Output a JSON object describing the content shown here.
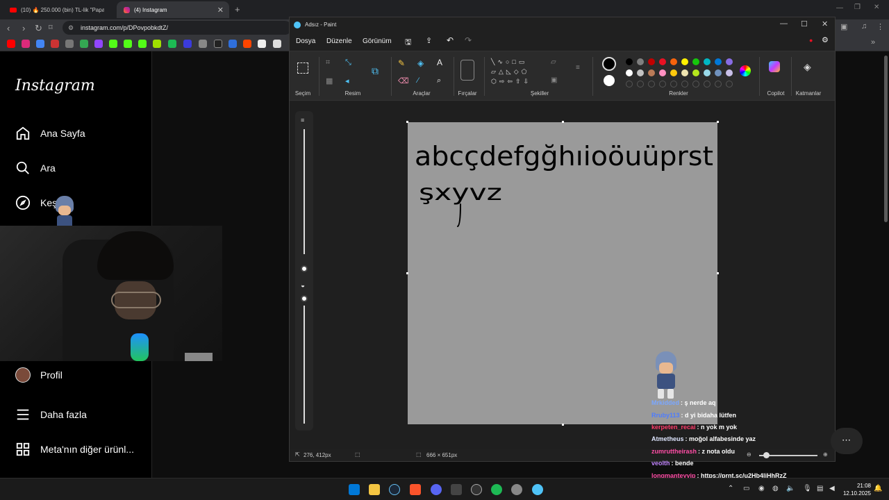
{
  "browser": {
    "tabs": [
      {
        "label": "(10) 🔥 250.000 (bin) TL-lik \"Papa",
        "active": false
      },
      {
        "label": "(4) Instagram",
        "active": true
      }
    ],
    "new_tab_label": "+",
    "url": "instagram.com/p/DPovpobkdtZ/"
  },
  "instagram": {
    "logo": "Instagram",
    "nav": [
      {
        "label": "Ana Sayfa",
        "icon": "home-icon"
      },
      {
        "label": "Ara",
        "icon": "search-icon"
      },
      {
        "label": "Keşfet",
        "icon": "compass-icon"
      },
      {
        "label": "Profil",
        "icon": "avatar"
      },
      {
        "label": "Daha fazla",
        "icon": "menu-icon"
      },
      {
        "label": "Meta'nın diğer ürünl...",
        "icon": "grid-icon"
      }
    ]
  },
  "paint": {
    "title": "Adsız - Paint",
    "menus": [
      "Dosya",
      "Düzenle",
      "Görünüm"
    ],
    "groups": [
      "Seçim",
      "Resim",
      "Araçlar",
      "Fırçalar",
      "Şekiller",
      "Renkler",
      "Copilot",
      "Katmanlar"
    ],
    "cursor_position": "276, 412px",
    "canvas_size": "666 × 651px",
    "canvas_text_line1": "abcçdefgğhıioöuüprst",
    "canvas_text_line2": "şxyvz",
    "palette_row1": [
      "#000000",
      "#7f7f7f",
      "#c00000",
      "#e81123",
      "#f7630c",
      "#fff100",
      "#16c60c",
      "#00b7c3",
      "#0078d7",
      "#886ce4"
    ],
    "palette_row2": [
      "#ffffff",
      "#c3c3c3",
      "#b97a57",
      "#ff8fc0",
      "#ffc90e",
      "#efe4b0",
      "#b5e61d",
      "#99d9ea",
      "#7092be",
      "#c8bfe7"
    ]
  },
  "chat": [
    {
      "user": "Mrkidded",
      "color": "#7aa7ff",
      "msg": ": ş nerde aq"
    },
    {
      "user": "Rruby113",
      "color": "#4d7cff",
      "msg": ": d yi bidaha lütfen"
    },
    {
      "user": "kerpeten_recai",
      "color": "#ff3b6b",
      "msg": ": n yok m yok"
    },
    {
      "user": "Atmetheus",
      "color": "#dfe6ff",
      "msg": ": moğol alfabesinde yaz"
    },
    {
      "user": "zumruttheirash",
      "color": "#ff4da6",
      "msg": ": z nota oldu"
    },
    {
      "user": "veolth",
      "color": "#c084fc",
      "msg": ": bende"
    },
    {
      "user": "longmanteyyip",
      "color": "#ff4da6",
      "msg": ": https://prnt.sc/u2Hb4liHhRzZ"
    }
  ],
  "taskbar": {
    "time": "21:08",
    "date": "12.10.2025"
  }
}
